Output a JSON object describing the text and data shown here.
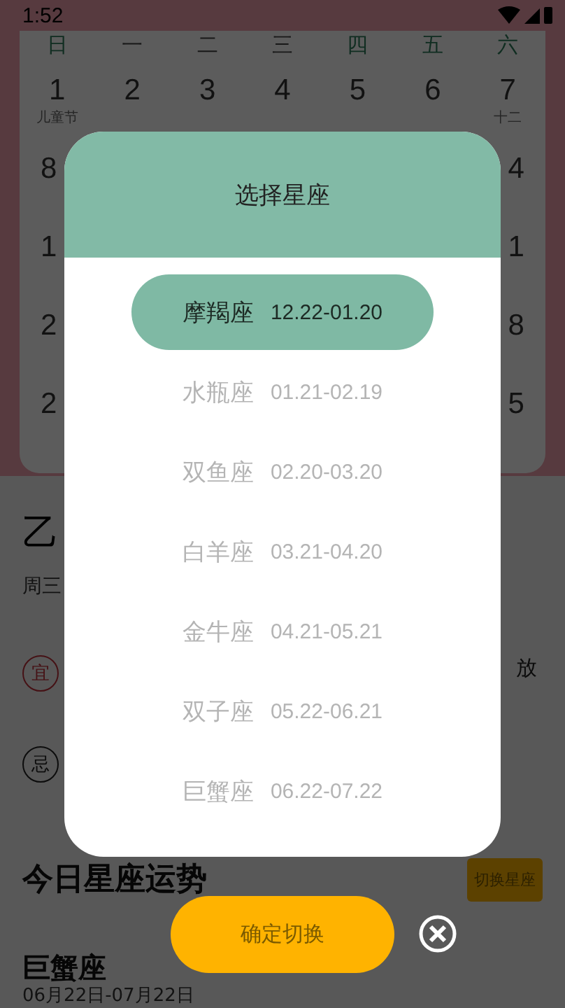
{
  "status_bar": {
    "time": "1:52"
  },
  "calendar": {
    "weekdays": [
      {
        "label": "日",
        "highlighted": true
      },
      {
        "label": "一",
        "highlighted": false
      },
      {
        "label": "二",
        "highlighted": false
      },
      {
        "label": "三",
        "highlighted": false
      },
      {
        "label": "四",
        "highlighted": true
      },
      {
        "label": "五",
        "highlighted": true
      },
      {
        "label": "六",
        "highlighted": true
      }
    ],
    "rows": [
      {
        "cells": [
          {
            "day": "1",
            "lunar": "儿童节"
          },
          {
            "day": "2"
          },
          {
            "day": "3"
          },
          {
            "day": "4"
          },
          {
            "day": "5"
          },
          {
            "day": "6"
          },
          {
            "day": "7",
            "lunar": "十二"
          }
        ]
      },
      {
        "cells": [
          {
            "day": "8"
          },
          null,
          null,
          null,
          null,
          null,
          {
            "day": "4"
          }
        ]
      },
      {
        "cells": [
          {
            "day": "1"
          },
          null,
          null,
          null,
          null,
          null,
          {
            "day": "1"
          }
        ]
      },
      {
        "cells": [
          {
            "day": "2"
          },
          null,
          null,
          null,
          null,
          null,
          {
            "day": "8"
          }
        ]
      },
      {
        "cells": [
          {
            "day": "2"
          },
          null,
          null,
          null,
          null,
          null,
          {
            "day": "5"
          }
        ]
      }
    ]
  },
  "today": {
    "year_text": "乙",
    "weekday": "周三",
    "good_badge": "宜",
    "bad_badge": "忌",
    "good_text": "放"
  },
  "horoscope": {
    "title": "今日星座运势",
    "switch_button": "切换星座",
    "sign": "巨蟹座",
    "dates": "06月22日-07月22日"
  },
  "dialog": {
    "title": "选择星座",
    "items": [
      {
        "name": "摩羯座",
        "range": "12.22-01.20",
        "selected": true
      },
      {
        "name": "水瓶座",
        "range": "01.21-02.19",
        "selected": false
      },
      {
        "name": "双鱼座",
        "range": "02.20-03.20",
        "selected": false
      },
      {
        "name": "白羊座",
        "range": "03.21-04.20",
        "selected": false
      },
      {
        "name": "金牛座",
        "range": "04.21-05.21",
        "selected": false
      },
      {
        "name": "双子座",
        "range": "05.22-06.21",
        "selected": false
      },
      {
        "name": "巨蟹座",
        "range": "06.22-07.22",
        "selected": false
      }
    ],
    "confirm_button": "确定切换"
  }
}
